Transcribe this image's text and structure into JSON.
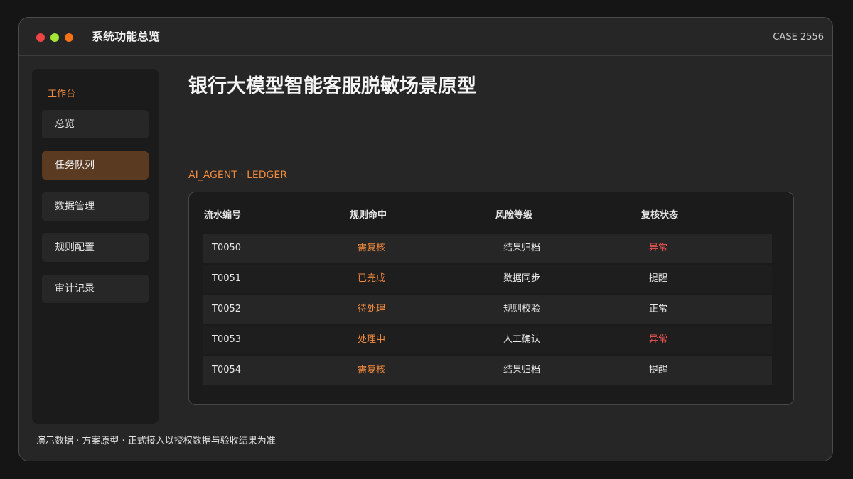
{
  "window": {
    "title": "系统功能总览",
    "case_id": "CASE 2556"
  },
  "sidebar": {
    "heading": "工作台",
    "items": [
      {
        "label": "总览",
        "active": false
      },
      {
        "label": "任务队列",
        "active": true
      },
      {
        "label": "数据管理",
        "active": false
      },
      {
        "label": "规则配置",
        "active": false
      },
      {
        "label": "审计记录",
        "active": false
      }
    ]
  },
  "main": {
    "title": "银行大模型智能客服脱敏场景原型",
    "section_label": "AI_AGENT · LEDGER",
    "table": {
      "headers": [
        "流水编号",
        "规则命中",
        "风险等级",
        "复核状态"
      ],
      "rows": [
        {
          "id": "T0050",
          "rule": "需复核",
          "risk": "结果归档",
          "status": "异常"
        },
        {
          "id": "T0051",
          "rule": "已完成",
          "risk": "数据同步",
          "status": "提醒"
        },
        {
          "id": "T0052",
          "rule": "待处理",
          "risk": "规则校验",
          "status": "正常"
        },
        {
          "id": "T0053",
          "rule": "处理中",
          "risk": "人工确认",
          "status": "异常"
        },
        {
          "id": "T0054",
          "rule": "需复核",
          "risk": "结果归档",
          "status": "提醒"
        }
      ]
    }
  },
  "footer": {
    "note": "演示数据 · 方案原型 · 正式接入以授权数据与验收结果为准"
  },
  "colors": {
    "accent": "#f28a3c",
    "active_nav": "#5a3a20",
    "status_alert": "#ef5350",
    "status_default": "#e8e8e8"
  }
}
